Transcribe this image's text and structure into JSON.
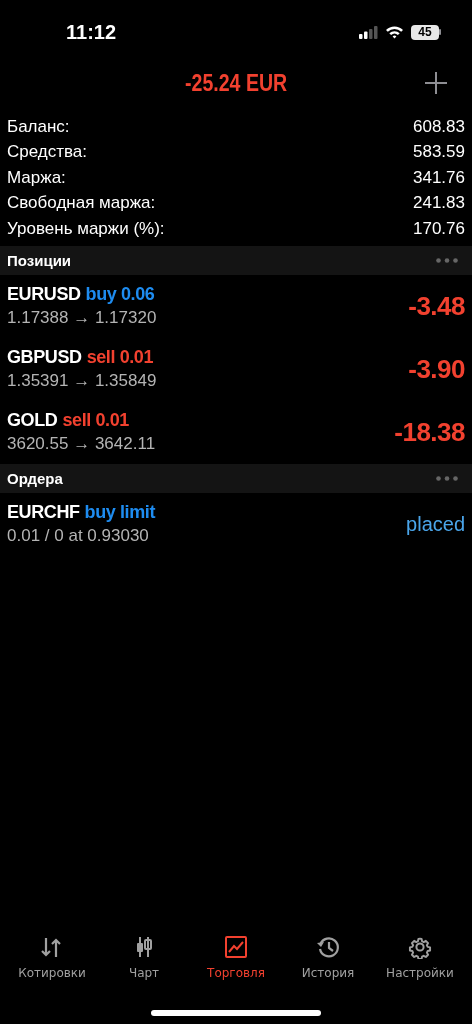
{
  "status_bar": {
    "time": "11:12",
    "battery": "45"
  },
  "header": {
    "total": "-25.24 EUR",
    "loss": true
  },
  "summary": [
    {
      "label": "Баланс:",
      "value": "608.83"
    },
    {
      "label": "Средства:",
      "value": "583.59"
    },
    {
      "label": "Маржа:",
      "value": "341.76"
    },
    {
      "label": "Свободная маржа:",
      "value": "241.83"
    },
    {
      "label": "Уровень маржи (%):",
      "value": "170.76"
    }
  ],
  "positions": {
    "title": "Позиции",
    "items": [
      {
        "symbol": "EURUSD",
        "kind": "buy",
        "side": "buy 0.06",
        "prices": "1.17388 → 1.17320",
        "profit": "-3.48",
        "loss": true
      },
      {
        "symbol": "GBPUSD",
        "kind": "sell",
        "side": "sell 0.01",
        "prices": "1.35391 → 1.35849",
        "profit": "-3.90",
        "loss": true
      },
      {
        "symbol": "GOLD",
        "kind": "sell",
        "side": "sell 0.01",
        "prices": "3620.55 → 3642.11",
        "profit": "-18.38",
        "loss": true
      }
    ]
  },
  "orders": {
    "title": "Ордера",
    "items": [
      {
        "symbol": "EURCHF",
        "kind": "buy",
        "side": "buy limit",
        "details": "0.01 / 0 at 0.93030",
        "status": "placed"
      }
    ]
  },
  "tabs": [
    {
      "label": "Котировки",
      "kind": "quotes",
      "selected": false
    },
    {
      "label": "Чарт",
      "kind": "chart",
      "selected": false
    },
    {
      "label": "Торговля",
      "kind": "trade",
      "selected": true
    },
    {
      "label": "История",
      "kind": "history",
      "selected": false
    },
    {
      "label": "Настройки",
      "kind": "settings",
      "selected": false
    }
  ]
}
